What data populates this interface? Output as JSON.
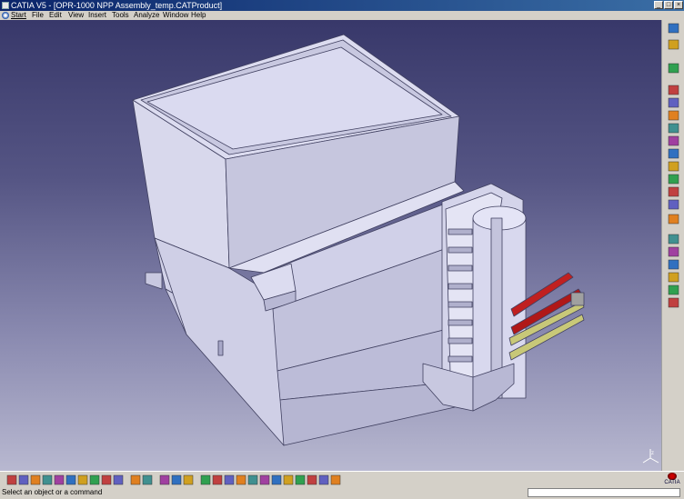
{
  "window": {
    "title": "CATIA V5 - [OPR-1000 NPP Assembly_temp.CATProduct]"
  },
  "window_controls": {
    "minimize": "_",
    "maximize": "□",
    "close": "×"
  },
  "menu": [
    "Start",
    "File",
    "Edit",
    "View",
    "Insert",
    "Tools",
    "Analyze",
    "Window",
    "Help"
  ],
  "colors": {
    "model_fill": "#d8d8ee",
    "model_edge": "#404060",
    "pipe_red": "#c02020",
    "pipe_yellow": "#c8c878"
  },
  "right_toolbar_icons": [
    "select-icon",
    "sketcher-icon",
    "part-icon",
    "assembly-constraint-icon",
    "fix-icon",
    "contact-icon",
    "offset-icon",
    "angle-icon",
    "coincidence-icon",
    "manipulate-icon",
    "snap-icon",
    "explode-icon",
    "update-icon",
    "catalog-icon",
    "measure-icon",
    "clash-icon",
    "section-icon",
    "distance-icon",
    "light-icon",
    "bug-icon"
  ],
  "bottom_toolbar_icons": [
    "new-icon",
    "open-icon",
    "save-icon",
    "print-icon",
    "cut-icon",
    "copy-icon",
    "paste-icon",
    "undo-icon",
    "redo-icon",
    "whats-this-icon",
    "formula-icon",
    "comment-icon",
    "catalog-icon",
    "material-icon",
    "apply-material-icon",
    "fly-mode-icon",
    "fit-all-icon",
    "pan-icon",
    "rotate-icon",
    "zoom-in-icon",
    "zoom-out-icon",
    "normal-view-icon",
    "multi-view-icon",
    "iso-view-icon",
    "shading-icon",
    "hide-show-icon",
    "swap-space-icon"
  ],
  "status": {
    "message": "Select an object or a command"
  },
  "logo": {
    "text": "CATIA"
  }
}
